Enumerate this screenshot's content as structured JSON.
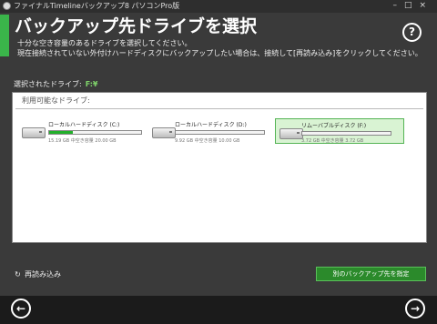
{
  "window": {
    "title": "ファイナルTimelineバックアップ8 パソコンPro版",
    "controls": "–□×"
  },
  "header": {
    "title": "バックアップ先ドライブを選択",
    "desc_line1": "十分な空き容量のあるドライブを選択してください。",
    "desc_line2": "現在接続されていない外付けハードディスクにバックアップしたい場合は、接続して[再読み込み]をクリックしてください。",
    "help_label": "?"
  },
  "selection": {
    "label": "選択されたドライブ:",
    "value": "F:¥"
  },
  "drives_panel": {
    "title": "利用可能なドライブ:",
    "drives": [
      {
        "name": "ローカルハードディスク (C:)",
        "stat": "15.19 GB 中空き容量 20.00 GB",
        "used_fraction": 0.26,
        "selected": false
      },
      {
        "name": "ローカルハードディスク (D:)",
        "stat": "9.92 GB 中空き容量 10.00 GB",
        "used_fraction": 0.0,
        "selected": false
      },
      {
        "name": "リムーバブルディスク (F:)",
        "stat": "3.72 GB 中空き容量 3.72 GB",
        "used_fraction": 0.0,
        "selected": true
      }
    ]
  },
  "actions": {
    "reload_label": "再読み込み",
    "other_dest_label": "別のバックアップ先を指定"
  },
  "nav": {
    "back": "←",
    "next": "→"
  },
  "colors": {
    "accent": "#3ab54a",
    "selected_bg": "#d9f3d3",
    "usage_fill": "#22b02b",
    "button": "#2b8a2b"
  }
}
